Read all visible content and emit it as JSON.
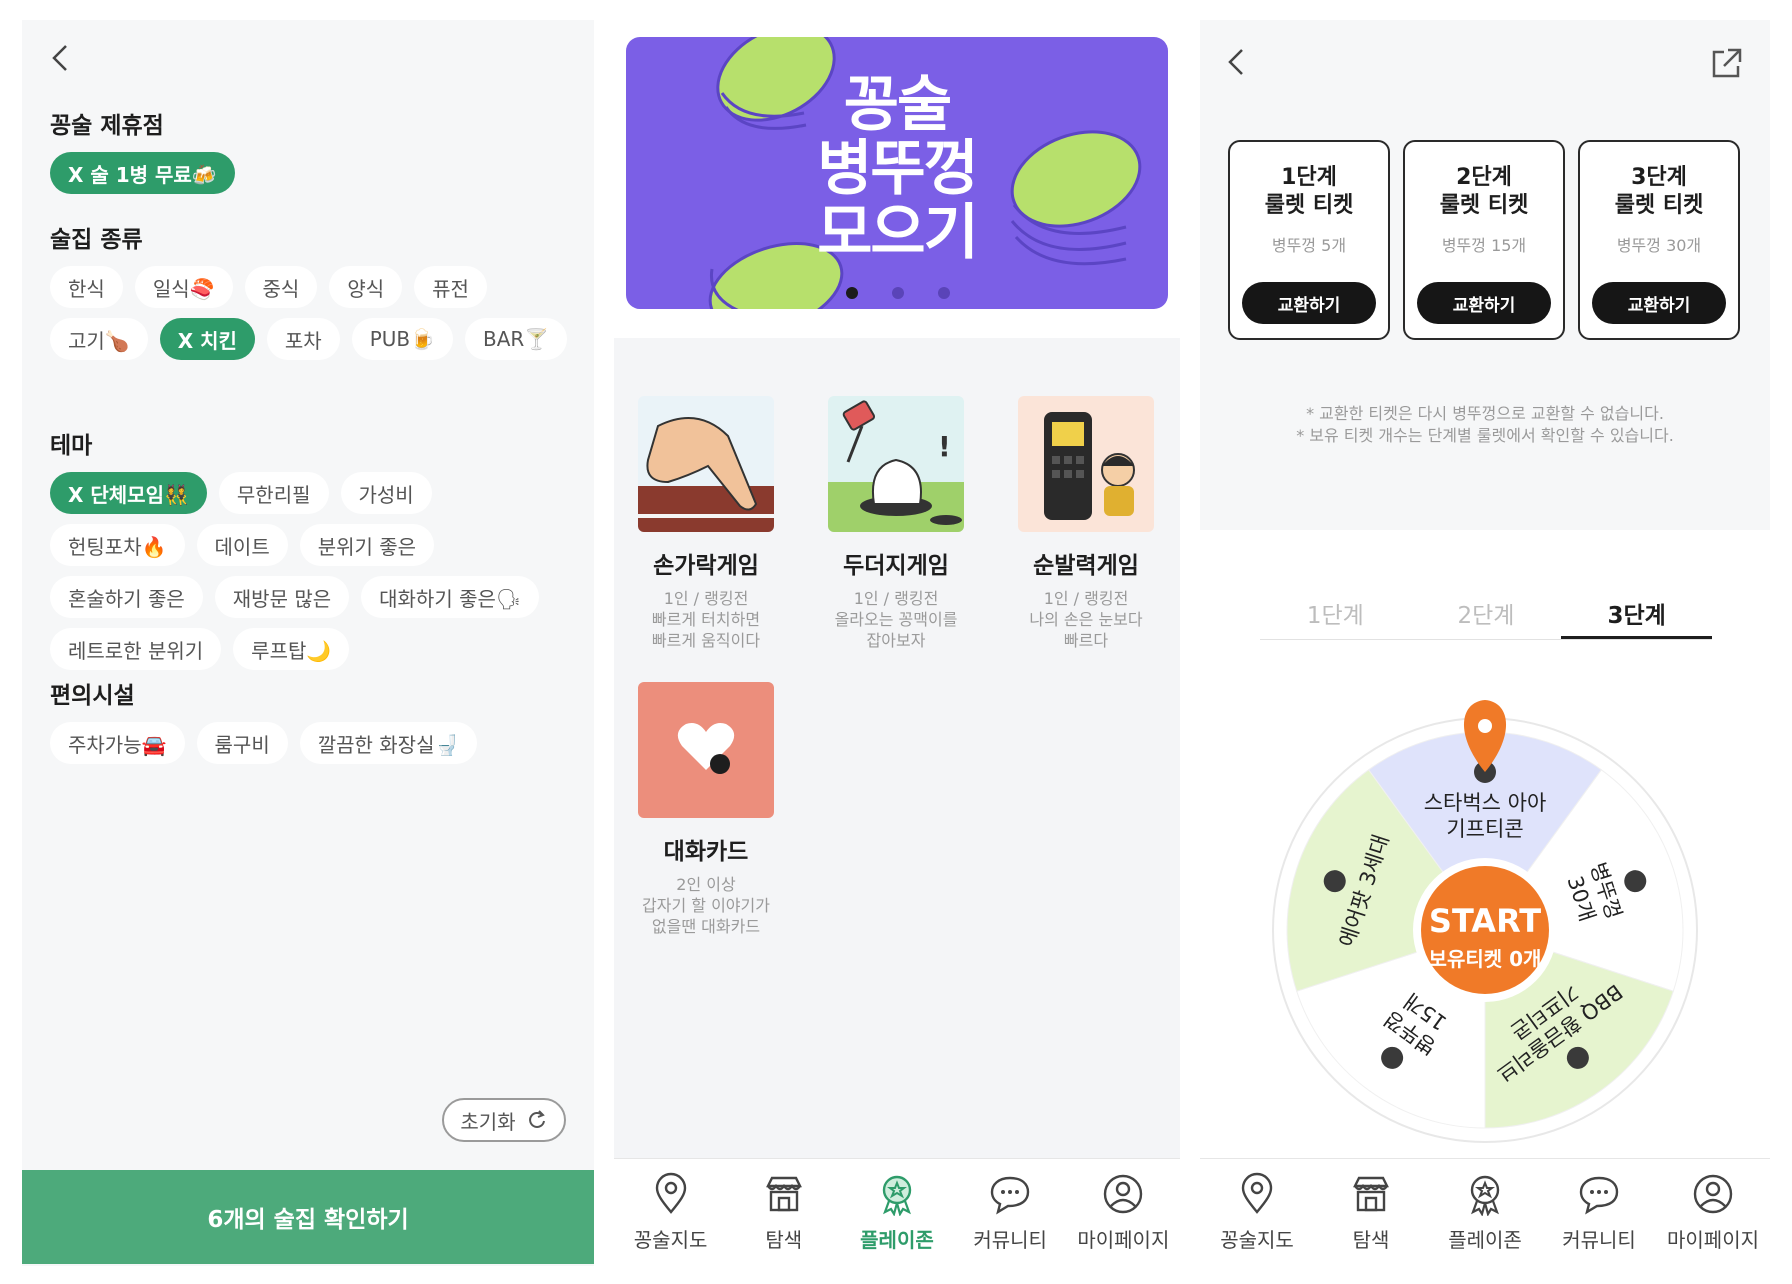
{
  "filter": {
    "sections": [
      {
        "title": "꽁술 제휴점",
        "chips": [
          {
            "label": "X 술 1병 무료🍻",
            "selected": true
          }
        ]
      },
      {
        "title": "술집 종류",
        "chips": [
          {
            "label": "한식",
            "selected": false
          },
          {
            "label": "일식🍣",
            "selected": false
          },
          {
            "label": "중식",
            "selected": false
          },
          {
            "label": "양식",
            "selected": false
          },
          {
            "label": "퓨전",
            "selected": false
          },
          {
            "label": "고기🍗",
            "selected": false
          },
          {
            "label": "X 치킨",
            "selected": true
          },
          {
            "label": "포차",
            "selected": false
          },
          {
            "label": "PUB🍺",
            "selected": false
          },
          {
            "label": "BAR🍸",
            "selected": false
          }
        ]
      },
      {
        "title": "테마",
        "chips": [
          {
            "label": "X 단체모임👯",
            "selected": true
          },
          {
            "label": "무한리필",
            "selected": false
          },
          {
            "label": "가성비",
            "selected": false
          },
          {
            "label": "헌팅포차🔥",
            "selected": false
          },
          {
            "label": "데이트",
            "selected": false
          },
          {
            "label": "분위기 좋은",
            "selected": false
          },
          {
            "label": "혼술하기 좋은",
            "selected": false
          },
          {
            "label": "재방문 많은",
            "selected": false
          },
          {
            "label": "대화하기 좋은🗣",
            "selected": false
          },
          {
            "label": "레트로한 분위기",
            "selected": false
          },
          {
            "label": "루프탑🌙",
            "selected": false
          }
        ]
      },
      {
        "title": "편의시설",
        "chips": [
          {
            "label": "주차가능🚘",
            "selected": false
          },
          {
            "label": "룸구비",
            "selected": false
          },
          {
            "label": "깔끔한 화장실🚽",
            "selected": false
          }
        ]
      }
    ],
    "reset_label": "초기화",
    "confirm_label": "6개의 술집 확인하기",
    "accent": "#2e9c6a",
    "confirm_color": "#4daa7b"
  },
  "playzone": {
    "banner": {
      "line1": "꽁술",
      "line2": "병뚜껑",
      "line3": "모으기",
      "color": "#7b5fe6",
      "page_count": 3,
      "active_page": 1
    },
    "games": [
      {
        "name": "손가락게임",
        "desc": "1인 / 랭킹전\n빠르게 터치하면\n빠르게 움직이다",
        "icon": "finger-icon"
      },
      {
        "name": "두더지게임",
        "desc": "1인 / 랭킹전\n올라오는 꽁맥이를\n잡아보자",
        "icon": "mole-icon"
      },
      {
        "name": "순발력게임",
        "desc": "1인 / 랭킹전\n나의 손은 눈보다\n빠르다",
        "icon": "phone-icon"
      },
      {
        "name": "대화카드",
        "desc": "2인 이상\n갑자기 할 이야기가\n없을땐 대화카드",
        "icon": "heart-bubble-icon"
      }
    ],
    "active_tab": "플레이존"
  },
  "nav": [
    {
      "label": "꽁술지도",
      "icon": "map-pin-icon"
    },
    {
      "label": "탐색",
      "icon": "store-icon"
    },
    {
      "label": "플레이존",
      "icon": "badge-icon"
    },
    {
      "label": "커뮤니티",
      "icon": "chat-icon"
    },
    {
      "label": "마이페이지",
      "icon": "user-icon"
    }
  ],
  "roulette": {
    "tickets": [
      {
        "title1": "1단계",
        "title2": "룰렛 티켓",
        "cost": "병뚜껑 5개",
        "button": "교환하기"
      },
      {
        "title1": "2단계",
        "title2": "룰렛 티켓",
        "cost": "병뚜껑 15개",
        "button": "교환하기"
      },
      {
        "title1": "3단계",
        "title2": "룰렛 티켓",
        "cost": "병뚜껑 30개",
        "button": "교환하기"
      }
    ],
    "notes": [
      "* 교환한 티켓은 다시 병뚜껑으로 교환할 수 없습니다.",
      "* 보유 티켓 개수는 단계별 룰렛에서 확인할 수 있습니다."
    ],
    "stages": [
      "1단계",
      "2단계",
      "3단계"
    ],
    "active_stage": "3단계",
    "prizes": [
      {
        "line1": "스타벅스 아아",
        "line2": "기프티콘",
        "color": "#dfe3fb",
        "icon": "coffee-icon"
      },
      {
        "line1": "병뚜껑",
        "line2": "30개",
        "color": "#ffffff",
        "icon": "bottlecap-icon"
      },
      {
        "line1": "BBQ 황금올리브",
        "line2": "기프티콘",
        "color": "#e6f4cf",
        "icon": "chicken-icon"
      },
      {
        "line1": "병뚜껑",
        "line2": "15개",
        "color": "#ffffff",
        "icon": "bottlecap-icon"
      },
      {
        "line1": "에어팟 3세대",
        "line2": "",
        "color": "#e6f4cf",
        "icon": "airpods-icon"
      }
    ],
    "start_label": "START",
    "ticket_label": "보유티켓 0개",
    "center_color": "#f07a28"
  }
}
